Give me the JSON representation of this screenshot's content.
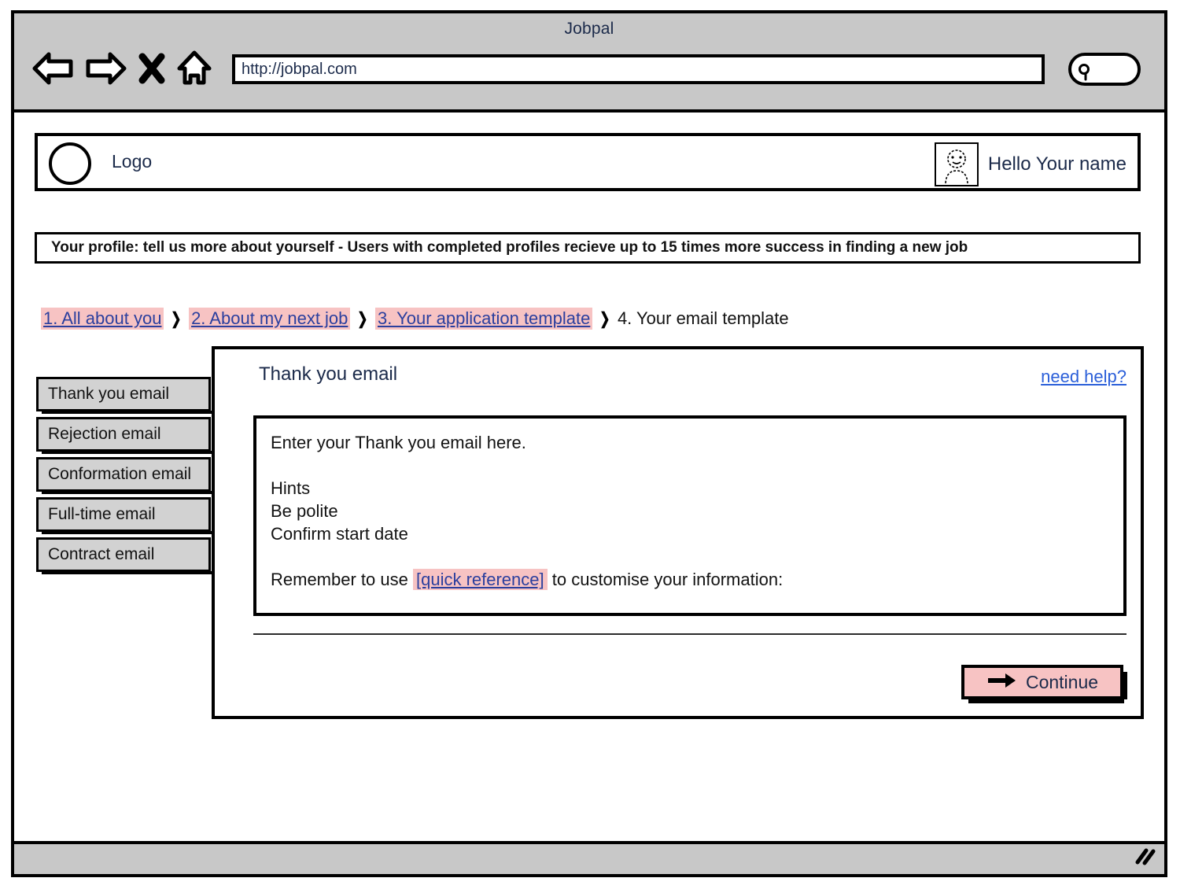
{
  "browser": {
    "window_title": "Jobpal",
    "url": "http://jobpal.com",
    "search_placeholder": "",
    "search_value": "",
    "icons": {
      "back": "back-arrow-icon",
      "forward": "forward-arrow-icon",
      "stop": "close-x-icon",
      "home": "home-icon",
      "search": "search-icon",
      "resize": "resize-grip-icon"
    }
  },
  "header": {
    "logo_label": "Logo",
    "greeting": "Hello Your name",
    "avatar_icon": "user-avatar-icon"
  },
  "promo": {
    "text": "Your profile: tell us more about yourself - Users with completed profiles recieve up to 15 times more success in finding a new job"
  },
  "breadcrumb": {
    "separator": "❯",
    "steps": [
      {
        "label": "1. All about you",
        "state": "link"
      },
      {
        "label": "2. About my next job",
        "state": "link"
      },
      {
        "label": "3. Your application template",
        "state": "link"
      },
      {
        "label": "4. Your email template",
        "state": "current"
      }
    ]
  },
  "tabs": [
    {
      "label": "Thank you email"
    },
    {
      "label": "Rejection email"
    },
    {
      "label": "Conformation email"
    },
    {
      "label": "Full-time email"
    },
    {
      "label": "Contract email"
    }
  ],
  "panel": {
    "title": "Thank you email",
    "help_link": "need help?",
    "editor": {
      "line1": "Enter your Thank you email here.",
      "line2": "Hints",
      "line3": "Be polite",
      "line4": "Confirm start date",
      "remember_prefix": "Remember to use",
      "remember_link": "[quick reference]",
      "remember_suffix": "to customise your information:"
    },
    "continue_label": "Continue",
    "continue_icon": "right-arrow-icon"
  },
  "colors": {
    "highlight_pink": "#f7c3c3",
    "link_blue": "#2b3f9e",
    "chrome_gray": "#c8c8c8",
    "tab_gray": "#d2d2d2"
  }
}
